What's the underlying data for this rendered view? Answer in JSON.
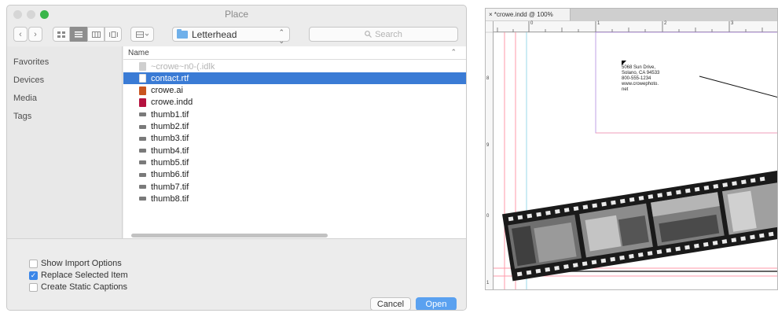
{
  "dialog": {
    "title": "Place",
    "traffic_colors": [
      "#d0d0d0",
      "#d0d0d0",
      "#36b24a"
    ],
    "toolbar": {
      "back_glyph": "‹",
      "forward_glyph": "›",
      "location": "Letterhead",
      "search_placeholder": "Search"
    },
    "sidebar": {
      "items": [
        "Favorites",
        "Devices",
        "Media",
        "Tags"
      ]
    },
    "column_header": "Name",
    "files": [
      {
        "name": "~crowe~n0-(.idlk",
        "icon": "lock-file-icon",
        "state": "dim"
      },
      {
        "name": "contact.rtf",
        "icon": "rtf-file-icon",
        "state": "selected"
      },
      {
        "name": "crowe.ai",
        "icon": "illustrator-file-icon",
        "state": "normal"
      },
      {
        "name": "crowe.indd",
        "icon": "indesign-file-icon",
        "state": "normal"
      },
      {
        "name": "thumb1.tif",
        "icon": "tif-file-icon",
        "state": "normal"
      },
      {
        "name": "thumb2.tif",
        "icon": "tif-file-icon",
        "state": "normal"
      },
      {
        "name": "thumb3.tif",
        "icon": "tif-file-icon",
        "state": "normal"
      },
      {
        "name": "thumb4.tif",
        "icon": "tif-file-icon",
        "state": "normal"
      },
      {
        "name": "thumb5.tif",
        "icon": "tif-file-icon",
        "state": "normal"
      },
      {
        "name": "thumb6.tif",
        "icon": "tif-file-icon",
        "state": "normal"
      },
      {
        "name": "thumb7.tif",
        "icon": "tif-file-icon",
        "state": "normal"
      },
      {
        "name": "thumb8.tif",
        "icon": "tif-file-icon",
        "state": "normal"
      }
    ],
    "options": [
      {
        "label": "Show Import Options",
        "checked": false
      },
      {
        "label": "Replace Selected Item",
        "checked": true
      },
      {
        "label": "Create Static Captions",
        "checked": false
      }
    ],
    "cancel_label": "Cancel",
    "open_label": "Open",
    "accent_color": "#3a7bd5"
  },
  "document": {
    "tab_label": "*crowe.indd @ 100%",
    "close_glyph": "×",
    "ruler_labels": [
      "0",
      "1",
      "2",
      "3"
    ],
    "vruler_labels": [
      "8",
      "9",
      "0",
      "1"
    ],
    "address_lines": "5068 Sun Drive,\nSolano, CA 94533\n800-555-1234\nwww.crowephoto.\nnet"
  }
}
